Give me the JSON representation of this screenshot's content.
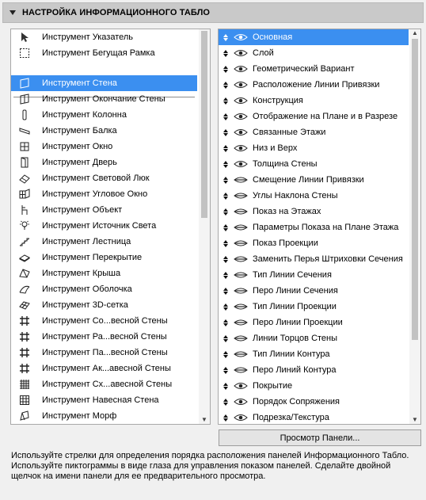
{
  "panel_title": "НАСТРОЙКА ИНФОРМАЦИОННОГО ТАБЛО",
  "tools_top": [
    {
      "label": "Инструмент Указатель",
      "icon": "pointer-arrow-icon"
    },
    {
      "label": "Инструмент Бегущая Рамка",
      "icon": "marquee-icon"
    }
  ],
  "tools": [
    {
      "label": "Инструмент Стена",
      "icon": "wall-icon",
      "selected": true
    },
    {
      "label": "Инструмент Окончание Стены",
      "icon": "wall-end-icon"
    },
    {
      "label": "Инструмент Колонна",
      "icon": "column-icon"
    },
    {
      "label": "Инструмент Балка",
      "icon": "beam-icon"
    },
    {
      "label": "Инструмент Окно",
      "icon": "window-icon"
    },
    {
      "label": "Инструмент Дверь",
      "icon": "door-icon"
    },
    {
      "label": "Инструмент Световой Люк",
      "icon": "skylight-icon"
    },
    {
      "label": "Инструмент Угловое Окно",
      "icon": "corner-window-icon"
    },
    {
      "label": "Инструмент Объект",
      "icon": "object-chair-icon"
    },
    {
      "label": "Инструмент Источник Света",
      "icon": "lamp-icon"
    },
    {
      "label": "Инструмент Лестница",
      "icon": "stair-icon"
    },
    {
      "label": "Инструмент Перекрытие",
      "icon": "slab-icon"
    },
    {
      "label": "Инструмент Крыша",
      "icon": "roof-icon"
    },
    {
      "label": "Инструмент Оболочка",
      "icon": "shell-icon"
    },
    {
      "label": "Инструмент 3D-сетка",
      "icon": "mesh-icon"
    },
    {
      "label": "Инструмент Со...весной Стены",
      "icon": "curtain-wall-grid-icon"
    },
    {
      "label": "Инструмент Ра...весной Стены",
      "icon": "curtain-wall-grid-icon"
    },
    {
      "label": "Инструмент Па...весной Стены",
      "icon": "curtain-wall-grid-icon"
    },
    {
      "label": "Инструмент Ак...авесной Стены",
      "icon": "curtain-wall-grid-icon"
    },
    {
      "label": "Инструмент Сх...авесной Стены",
      "icon": "curtain-wall-dense-icon"
    },
    {
      "label": "Инструмент Навесная Стена",
      "icon": "curtain-wall-icon"
    },
    {
      "label": "Инструмент Морф",
      "icon": "morph-icon"
    }
  ],
  "panels": [
    {
      "label": "Основная",
      "visible": true,
      "selected": true
    },
    {
      "label": "Слой",
      "visible": true
    },
    {
      "label": "Геометрический Вариант",
      "visible": true
    },
    {
      "label": "Расположение Линии Привязки",
      "visible": true
    },
    {
      "label": "Конструкция",
      "visible": true
    },
    {
      "label": "Отображение на Плане и в Разрезе",
      "visible": true
    },
    {
      "label": "Связанные Этажи",
      "visible": true
    },
    {
      "label": "Низ и Верх",
      "visible": true
    },
    {
      "label": "Толщина Стены",
      "visible": true
    },
    {
      "label": "Смещение Линии Привязки",
      "visible": false
    },
    {
      "label": "Углы Наклона Стены",
      "visible": false
    },
    {
      "label": "Показ на Этажах",
      "visible": false
    },
    {
      "label": "Параметры Показа на Плане Этажа",
      "visible": false
    },
    {
      "label": "Показ Проекции",
      "visible": false
    },
    {
      "label": "Заменить Перья Штриховки Сечения",
      "visible": false
    },
    {
      "label": "Тип Линии Сечения",
      "visible": false
    },
    {
      "label": "Перо Линии Сечения",
      "visible": false
    },
    {
      "label": "Тип Линии Проекции",
      "visible": false
    },
    {
      "label": "Перо Линии Проекции",
      "visible": false
    },
    {
      "label": "Линии Торцов Стены",
      "visible": false
    },
    {
      "label": "Тип Линии Контура",
      "visible": false
    },
    {
      "label": "Перо Линий Контура",
      "visible": false
    },
    {
      "label": "Покрытие",
      "visible": true
    },
    {
      "label": "Порядок Сопряжения",
      "visible": true
    },
    {
      "label": "Подрезка/Текстура",
      "visible": true
    }
  ],
  "preview_button": "Просмотр Панели...",
  "help_text": "Используйте стрелки для определения порядка расположения панелей Информационного Табло. Используйте пиктограммы в виде глаза для управления показом панелей. Сделайте двойной щелчок на имени панели для ее предварительного просмотра.",
  "colors": {
    "selection": "#3b8ff0",
    "header": "#c9c9c9",
    "background": "#f0f0f0"
  }
}
